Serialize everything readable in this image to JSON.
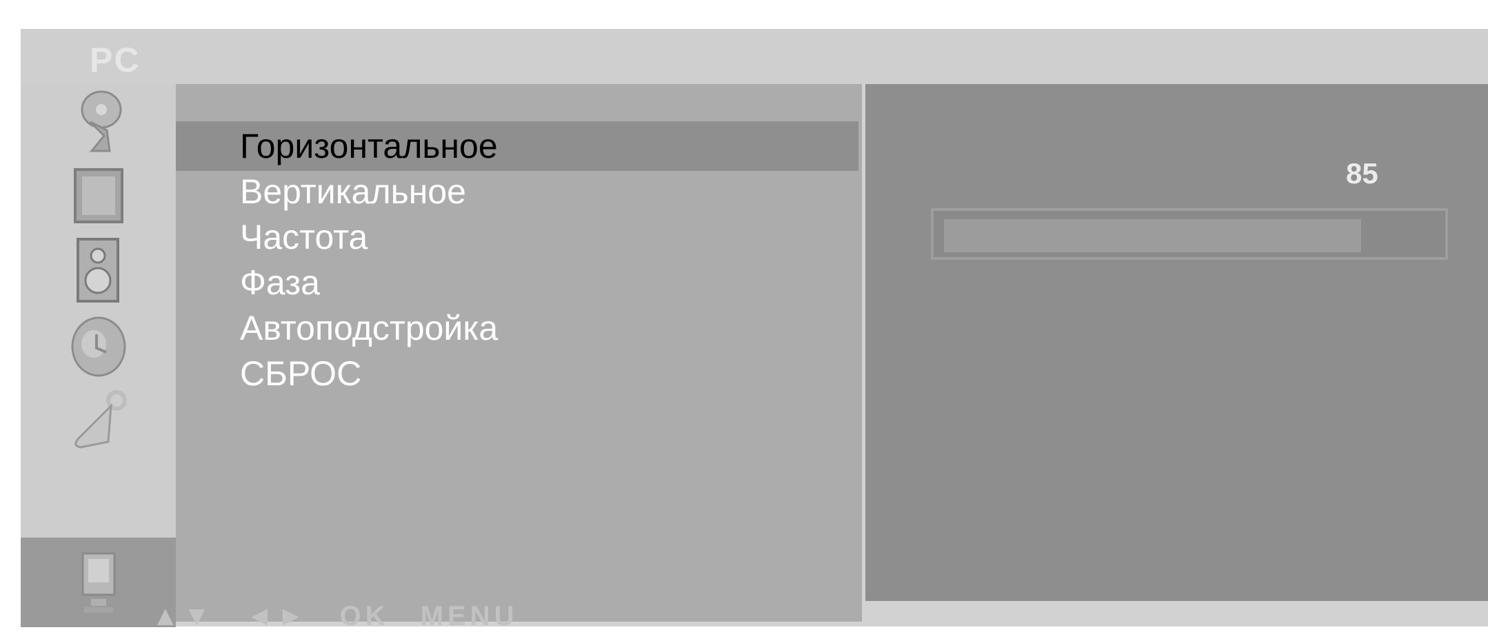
{
  "osd": {
    "title": "PC",
    "category_icons": [
      {
        "name": "antenna-icon",
        "active": false
      },
      {
        "name": "picture-icon",
        "active": false
      },
      {
        "name": "speaker-icon",
        "active": false
      },
      {
        "name": "clock-icon",
        "active": false
      },
      {
        "name": "wrench-icon",
        "active": false
      },
      {
        "name": "pc-monitor-icon",
        "active": true
      }
    ],
    "menu_items": [
      {
        "label": "Горизонтальное",
        "selected": true
      },
      {
        "label": "Вертикальное",
        "selected": false
      },
      {
        "label": "Частота",
        "selected": false
      },
      {
        "label": "Фаза",
        "selected": false
      },
      {
        "label": "Автоподстройка",
        "selected": false
      },
      {
        "label": "СБРОС",
        "selected": false
      }
    ],
    "value_panel": {
      "value": "85",
      "slider_level": 0.85
    },
    "footer_hint": "▲▼ ◄► OK MENU",
    "colors": {
      "background": "#d2d2d2",
      "menu_panel": "#acacac",
      "selected_row": "#8f8f8f",
      "value_panel": "#8e8e8e"
    }
  }
}
